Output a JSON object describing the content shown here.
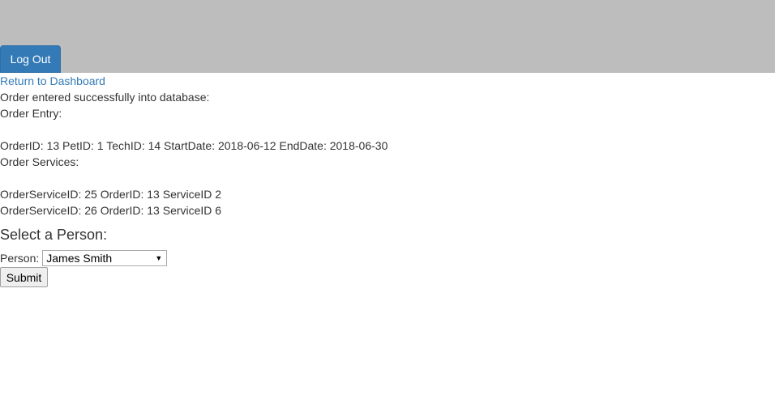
{
  "header": {
    "logout_label": "Log Out"
  },
  "nav": {
    "return_link": "Return to Dashboard"
  },
  "status": {
    "success_message": "Order entered successfully into database:"
  },
  "order_entry": {
    "heading": "Order Entry:",
    "details": "OrderID: 13 PetID: 1 TechID: 14 StartDate: 2018-06-12 EndDate: 2018-06-30"
  },
  "order_services": {
    "heading": "Order Services:",
    "rows": [
      "OrderServiceID: 25 OrderID: 13 ServiceID 2",
      "OrderServiceID: 26 OrderID: 13 ServiceID 6"
    ]
  },
  "person_form": {
    "title": "Select a Person:",
    "person_label": "Person:",
    "selected_person": "James Smith",
    "submit_label": "Submit"
  },
  "colors": {
    "header_bg": "#bdbdbd",
    "primary_button": "#337ab7",
    "link": "#337ab7"
  }
}
